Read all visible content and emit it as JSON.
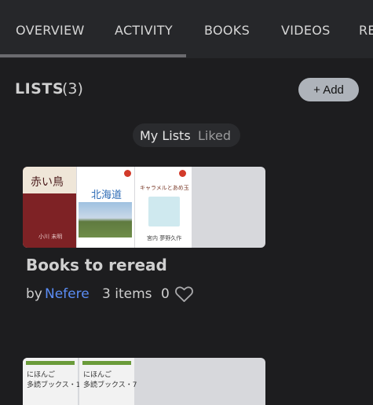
{
  "tabs": [
    {
      "label": "OVERVIEW",
      "active": true
    },
    {
      "label": "ACTIVITY"
    },
    {
      "label": "BOOKS"
    },
    {
      "label": "VIDEOS"
    },
    {
      "label": "RE"
    }
  ],
  "lists_section": {
    "title": "LISTS",
    "count": "(3)",
    "add_label": "+ Add"
  },
  "segmented": {
    "options": [
      "My Lists",
      "Liked"
    ],
    "selected": "My Lists"
  },
  "list_card": {
    "covers": [
      {
        "title": "赤い鳥",
        "author": "小川 未明"
      },
      {
        "title": "北海道"
      },
      {
        "title": "キャラメルとあめ玉",
        "author": "宮内 夢野久作"
      }
    ],
    "title": "Books to reread",
    "by_label": "by",
    "user": "Nefere",
    "items": "3 items",
    "likes": "0"
  },
  "list_card_2": {
    "covers": [
      {
        "line1": "にほんご",
        "line2": "多読ブックス・1"
      },
      {
        "line1": "にほんご",
        "line2": "多読ブックス・7"
      }
    ]
  },
  "colors": {
    "accent_link": "#5b8df5",
    "add_button": "#aeb3ba",
    "background": "#1d1d1f"
  }
}
